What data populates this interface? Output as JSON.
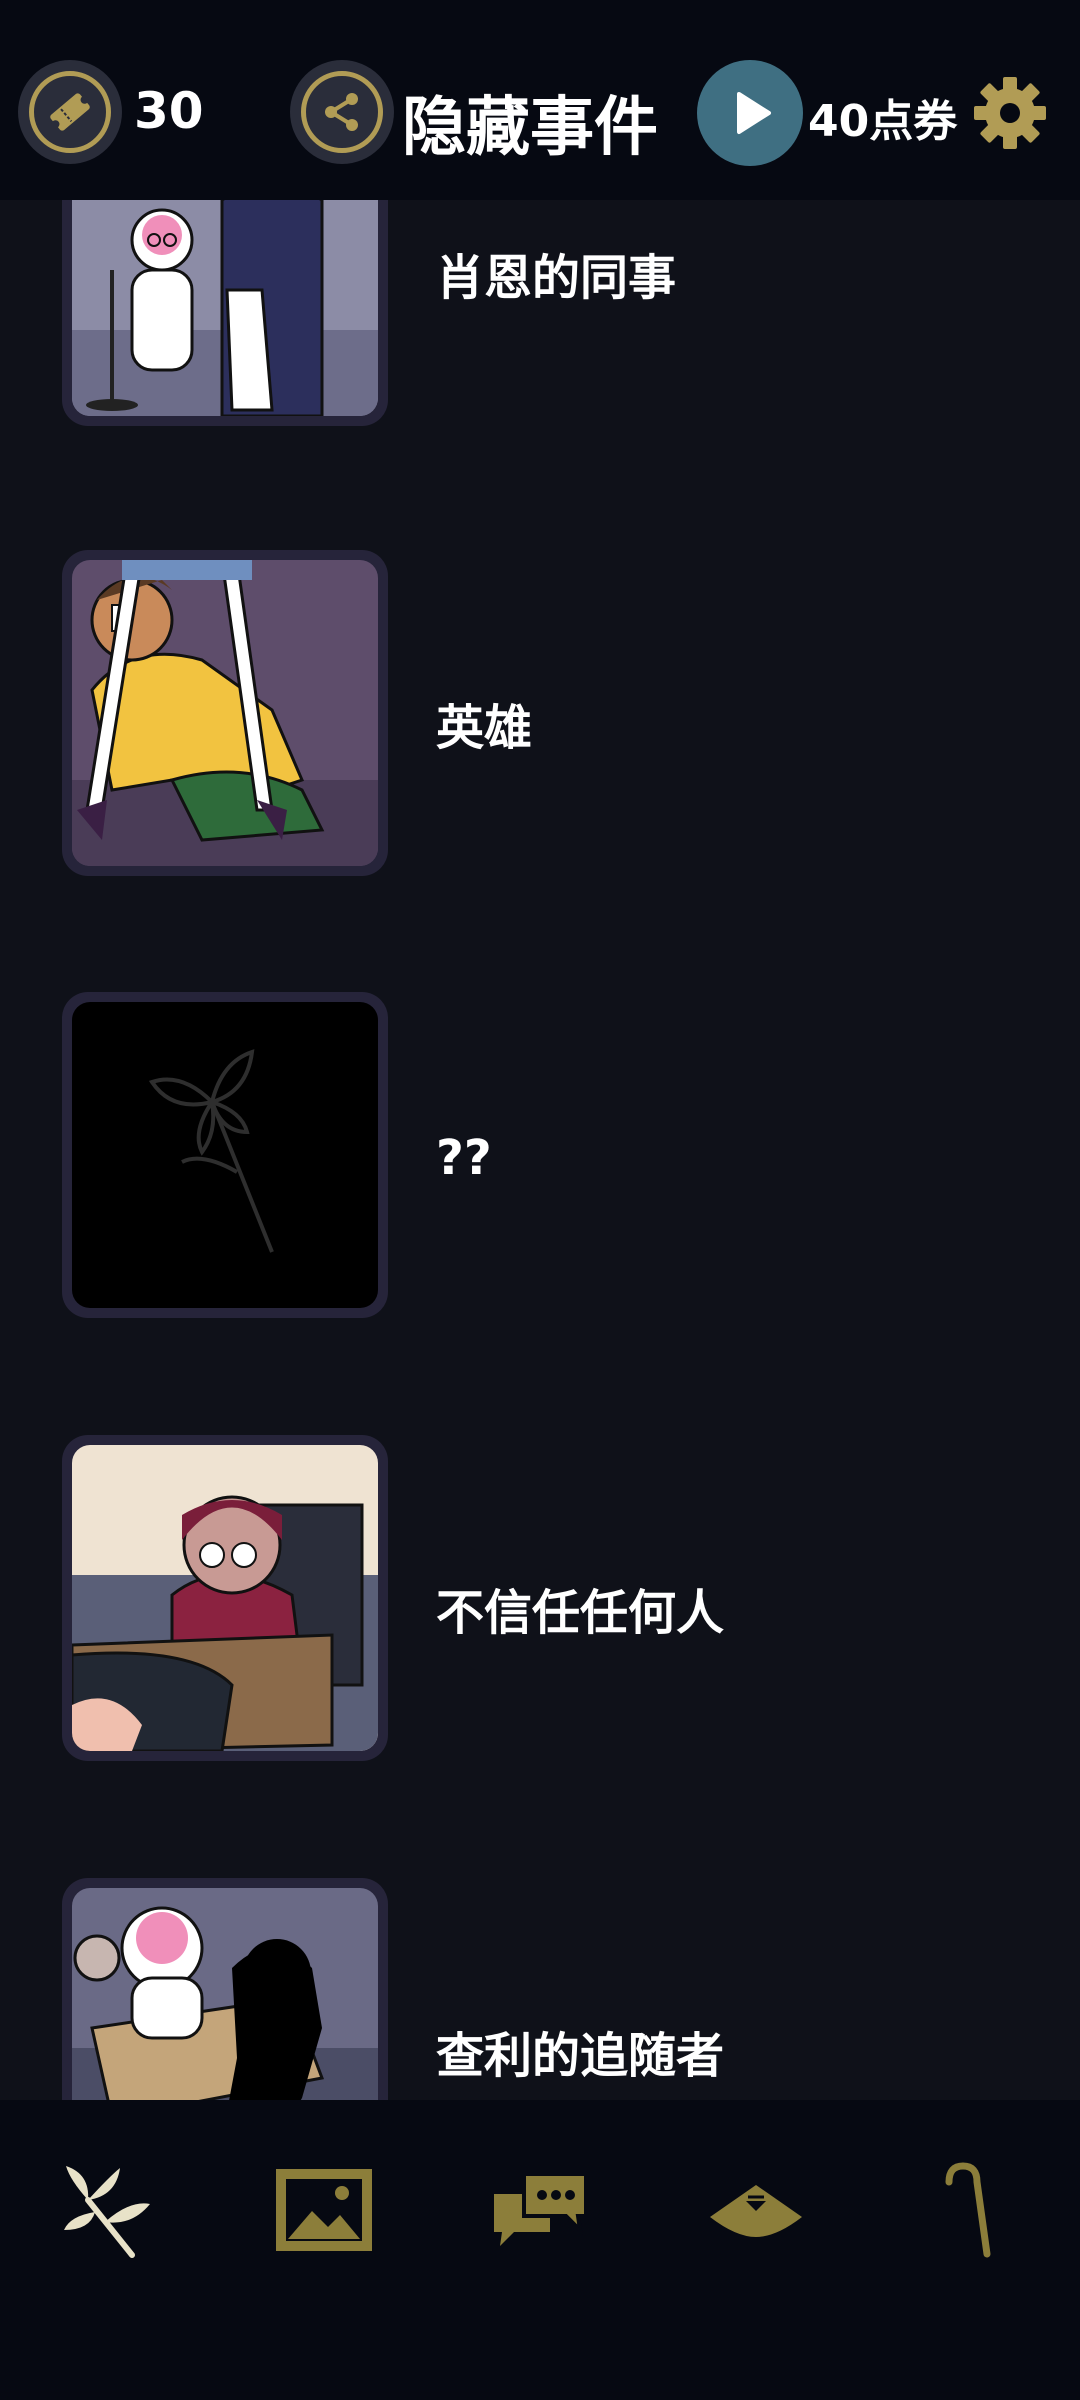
{
  "header": {
    "ticket_count": "30",
    "title": "隐藏事件",
    "points_label": "40点券"
  },
  "events": [
    {
      "title": "肖恩的同事",
      "thumb": "colleague-scene"
    },
    {
      "title": "英雄",
      "thumb": "hero-scene"
    },
    {
      "title": "??",
      "thumb": "locked-flower"
    },
    {
      "title": "不信任任何人",
      "thumb": "classroom-scene"
    },
    {
      "title": "查利的追随者",
      "thumb": "follower-scene"
    }
  ],
  "bottom_nav": {
    "items": [
      "flower-icon",
      "gallery-icon",
      "chat-icon",
      "hat-icon",
      "cane-icon"
    ]
  },
  "colors": {
    "background": "#0f1119",
    "bar": "#060912",
    "accent_gold": "#b19c55",
    "play_blue": "#3f6f82",
    "nav_olive": "#8c7e3a"
  }
}
